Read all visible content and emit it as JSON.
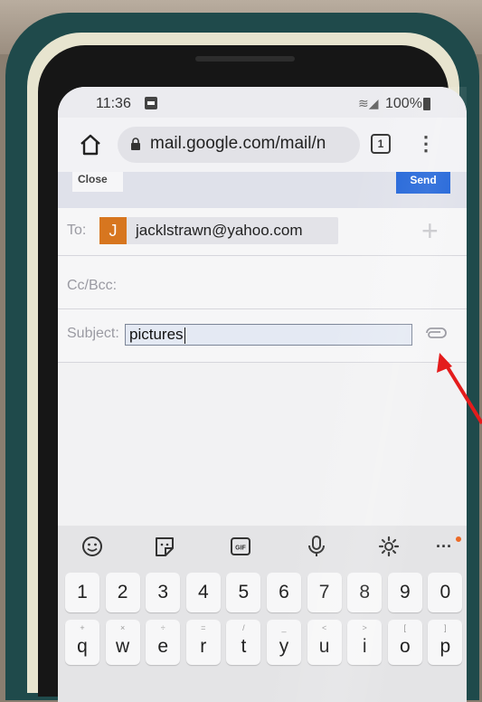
{
  "status_bar": {
    "time": "11:36",
    "battery": "100%"
  },
  "browser": {
    "url": "mail.google.com/mail/n",
    "tab_count": "1",
    "menu_glyph": "⋮"
  },
  "compose": {
    "close_label": "Close",
    "send_label": "Send",
    "to_label": "To:",
    "recipient_initial": "J",
    "recipient_email": "jacklstrawn@yahoo.com",
    "add_glyph": "+",
    "cc_label": "Cc/Bcc:",
    "subject_label": "Subject:",
    "subject_value": "pictures"
  },
  "keyboard": {
    "toolbar": [
      "emoji-icon",
      "sticker-icon",
      "gif-icon",
      "microphone-icon",
      "settings-icon",
      "more-icon"
    ],
    "gif_label": "GIF",
    "more_glyph": "···",
    "number_row": [
      "1",
      "2",
      "3",
      "4",
      "5",
      "6",
      "7",
      "8",
      "9",
      "0"
    ],
    "letter_row": [
      "q",
      "w",
      "e",
      "r",
      "t",
      "y",
      "u",
      "i",
      "o",
      "p"
    ],
    "letter_hints": [
      "+",
      "×",
      "÷",
      "=",
      "/",
      "_",
      "<",
      ">",
      "[",
      "]"
    ]
  },
  "colors": {
    "send_button": "#1f63d8",
    "avatar": "#d7761f",
    "annotation_arrow": "#e41c1c",
    "phone_case": "#1f4a4b"
  }
}
